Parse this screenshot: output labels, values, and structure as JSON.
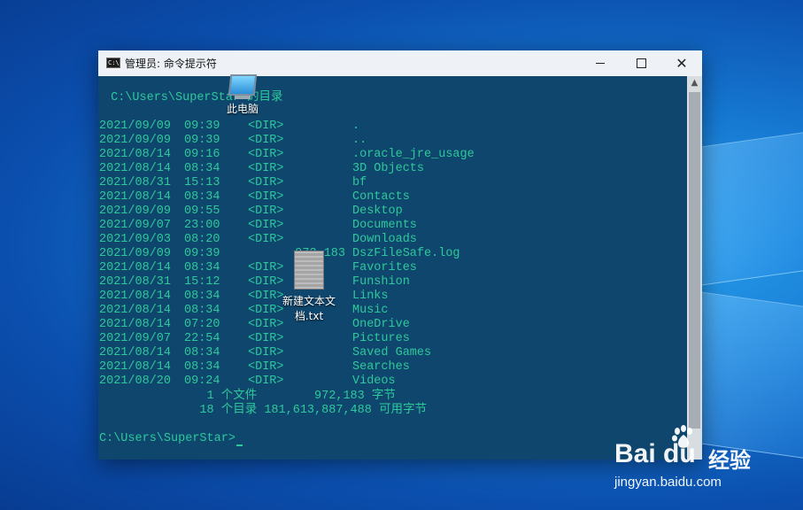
{
  "window": {
    "title": "管理员: 命令提示符",
    "icon_label": "C:\\",
    "close_glyph": "✕"
  },
  "console": {
    "header": " C:\\Users\\SuperStar 的目录",
    "entries": [
      {
        "date": "2021/09/09",
        "time": "09:39",
        "type": "<DIR>",
        "size": "",
        "name": "."
      },
      {
        "date": "2021/09/09",
        "time": "09:39",
        "type": "<DIR>",
        "size": "",
        "name": ".."
      },
      {
        "date": "2021/08/14",
        "time": "09:16",
        "type": "<DIR>",
        "size": "",
        "name": ".oracle_jre_usage"
      },
      {
        "date": "2021/08/14",
        "time": "08:34",
        "type": "<DIR>",
        "size": "",
        "name": "3D Objects"
      },
      {
        "date": "2021/08/31",
        "time": "15:13",
        "type": "<DIR>",
        "size": "",
        "name": "bf"
      },
      {
        "date": "2021/08/14",
        "time": "08:34",
        "type": "<DIR>",
        "size": "",
        "name": "Contacts"
      },
      {
        "date": "2021/09/09",
        "time": "09:55",
        "type": "<DIR>",
        "size": "",
        "name": "Desktop"
      },
      {
        "date": "2021/09/07",
        "time": "23:00",
        "type": "<DIR>",
        "size": "",
        "name": "Documents"
      },
      {
        "date": "2021/09/03",
        "time": "08:20",
        "type": "<DIR>",
        "size": "",
        "name": "Downloads"
      },
      {
        "date": "2021/09/09",
        "time": "09:39",
        "type": "",
        "size": "972,183",
        "name": "DszFileSafe.log"
      },
      {
        "date": "2021/08/14",
        "time": "08:34",
        "type": "<DIR>",
        "size": "",
        "name": "Favorites"
      },
      {
        "date": "2021/08/31",
        "time": "15:12",
        "type": "<DIR>",
        "size": "",
        "name": "Funshion"
      },
      {
        "date": "2021/08/14",
        "time": "08:34",
        "type": "<DIR>",
        "size": "",
        "name": "Links"
      },
      {
        "date": "2021/08/14",
        "time": "08:34",
        "type": "<DIR>",
        "size": "",
        "name": "Music"
      },
      {
        "date": "2021/08/14",
        "time": "07:20",
        "type": "<DIR>",
        "size": "",
        "name": "OneDrive"
      },
      {
        "date": "2021/09/07",
        "time": "22:54",
        "type": "<DIR>",
        "size": "",
        "name": "Pictures"
      },
      {
        "date": "2021/08/14",
        "time": "08:34",
        "type": "<DIR>",
        "size": "",
        "name": "Saved Games"
      },
      {
        "date": "2021/08/14",
        "time": "08:34",
        "type": "<DIR>",
        "size": "",
        "name": "Searches"
      },
      {
        "date": "2021/08/20",
        "time": "09:24",
        "type": "<DIR>",
        "size": "",
        "name": "Videos"
      }
    ],
    "summary_files": "               1 个文件        972,183 字节",
    "summary_dirs": "              18 个目录 181,613,887,488 可用字节",
    "prompt": "C:\\Users\\SuperStar>",
    "text_color": "#2ec99a"
  },
  "desktop": {
    "icon_pc_label": "此电脑",
    "icon_txt_label": "新建文本文档.txt"
  },
  "watermark": {
    "brand": "Bai  du",
    "jingyan": "经验",
    "url": "jingyan.baidu.com"
  }
}
